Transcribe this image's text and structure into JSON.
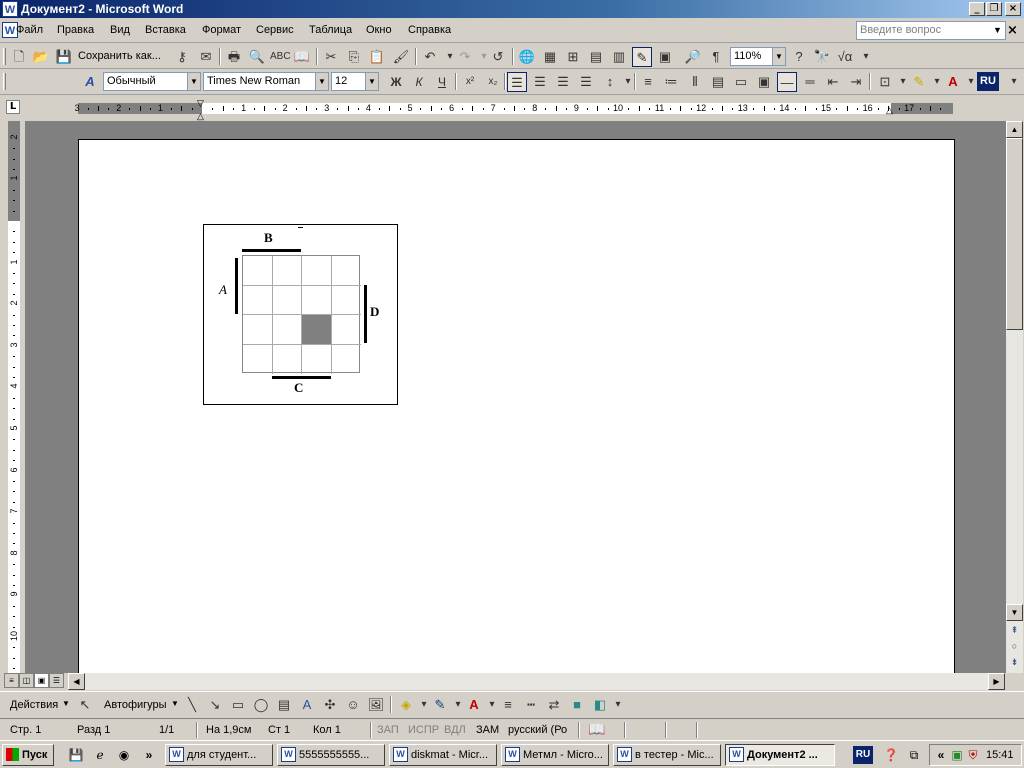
{
  "window": {
    "title": "Документ2 - Microsoft Word"
  },
  "menu": [
    "Файл",
    "Правка",
    "Вид",
    "Вставка",
    "Формат",
    "Сервис",
    "Таблица",
    "Окно",
    "Справка"
  ],
  "help_box": {
    "placeholder": "Введите вопрос"
  },
  "standard_toolbar": {
    "save_as_label": "Сохранить как...",
    "zoom": "110%"
  },
  "formatting_toolbar": {
    "style": "Обычный",
    "font": "Times New Roman",
    "size": "12",
    "bold_label": "Ж",
    "italic_label": "К",
    "underline_label": "Ч",
    "language_badge": "RU"
  },
  "ruler": {
    "left_numbers": [
      "3",
      "2",
      "1"
    ],
    "right_numbers": [
      "1",
      "2",
      "3",
      "4",
      "5",
      "6",
      "7",
      "8",
      "9",
      "10",
      "11",
      "12",
      "13",
      "14",
      "15",
      "16",
      "17"
    ],
    "vertical_top": [
      "2",
      "1"
    ],
    "vertical_numbers": [
      "1",
      "2",
      "3",
      "4",
      "5",
      "6",
      "7",
      "8",
      "9",
      "10"
    ]
  },
  "figure": {
    "labels": {
      "top": "B",
      "left": "A",
      "right": "D",
      "bottom": "C"
    },
    "shaded_cell": {
      "row": 2,
      "col": 2
    }
  },
  "drawing_toolbar": {
    "actions_label": "Действия",
    "autoshapes_label": "Автофигуры"
  },
  "status": {
    "page": "Стр.  1",
    "section": "Разд  1",
    "pages": "1/1",
    "at": "На  1,9см",
    "line": "Ст  1",
    "col": "Кол  1",
    "rec": "ЗАП",
    "trk": "ИСПР",
    "ext": "ВДЛ",
    "ovr": "ЗАМ",
    "language": "русский (Ро"
  },
  "taskbar": {
    "start_label": "Пуск",
    "tasks": [
      "для студент...",
      "5555555555...",
      "diskmat - Micr...",
      "Метмл - Micro...",
      "в тестер - Mic...",
      "Документ2 ..."
    ],
    "language": "RU",
    "clock": "15:41"
  }
}
